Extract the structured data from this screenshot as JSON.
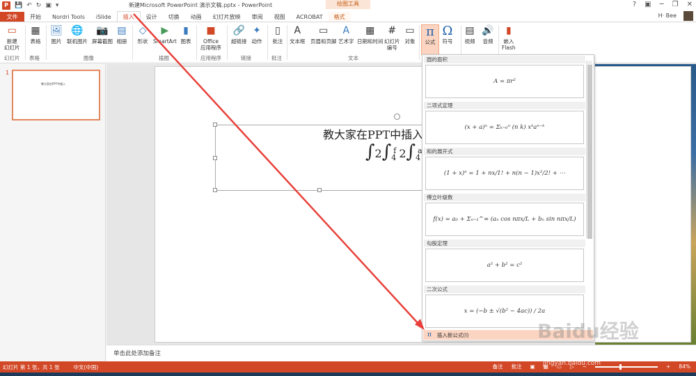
{
  "titlebar": {
    "title": "新建Microsoft PowerPoint 演示文稿.pptx - PowerPoint",
    "drawing_tools": "绘图工具",
    "help": "?"
  },
  "tabs": [
    "文件",
    "开始",
    "Nordri Tools",
    "iSlide",
    "插入",
    "设计",
    "切换",
    "动画",
    "幻灯片放映",
    "审阅",
    "视图",
    "ACROBAT",
    "格式"
  ],
  "user": "H· Bee",
  "ribbon": {
    "buttons": [
      {
        "label": "新建\n幻灯片",
        "icon": "new-slide-icon"
      },
      {
        "label": "表格",
        "icon": "table-icon"
      },
      {
        "label": "图片",
        "icon": "picture-icon"
      },
      {
        "label": "联机图片",
        "icon": "online-picture-icon"
      },
      {
        "label": "屏幕截图",
        "icon": "screenshot-icon"
      },
      {
        "label": "相册",
        "icon": "album-icon"
      },
      {
        "label": "形状",
        "icon": "shapes-icon"
      },
      {
        "label": "SmartArt",
        "icon": "smartart-icon"
      },
      {
        "label": "图表",
        "icon": "chart-icon"
      },
      {
        "label": "Office\n应用程序",
        "icon": "office-apps-icon"
      },
      {
        "label": "超链接",
        "icon": "hyperlink-icon"
      },
      {
        "label": "动作",
        "icon": "action-icon"
      },
      {
        "label": "批注",
        "icon": "comment-icon"
      },
      {
        "label": "文本框",
        "icon": "textbox-icon"
      },
      {
        "label": "页眉和页脚",
        "icon": "header-footer-icon"
      },
      {
        "label": "艺术字",
        "icon": "wordart-icon"
      },
      {
        "label": "日期和时间",
        "icon": "datetime-icon"
      },
      {
        "label": "幻灯片\n编号",
        "icon": "slide-number-icon"
      },
      {
        "label": "对象",
        "icon": "object-icon"
      },
      {
        "label": "公式",
        "icon": "pi-icon"
      },
      {
        "label": "符号",
        "icon": "omega-icon"
      },
      {
        "label": "视频",
        "icon": "video-icon"
      },
      {
        "label": "音频",
        "icon": "audio-icon"
      },
      {
        "label": "嵌入\nFlash",
        "icon": "flash-icon"
      }
    ],
    "groups": [
      "幻灯片",
      "表格",
      "图像",
      "插图",
      "应用程序",
      "链接",
      "批注",
      "文本"
    ]
  },
  "slide_panel": {
    "number": "1"
  },
  "slide": {
    "title": "教大家在PPT中插入",
    "formula": "∫2∫₄ᶠ2∫₄ᵃ"
  },
  "notes_placeholder": "单击此处添加备注",
  "equation_gallery": {
    "items": [
      {
        "header": "圆的面积",
        "formula": "A = πr²"
      },
      {
        "header": "二项式定理",
        "formula": "(x + a)ⁿ = Σₖ₌₀ⁿ (n k) xᵏaⁿ⁻ᵏ"
      },
      {
        "header": "和的展开式",
        "formula": "(1 + x)ⁿ = 1 + nx/1! + n(n − 1)x²/2! + ⋯"
      },
      {
        "header": "傅立叶级数",
        "formula": "f(x) = a₀ + Σₙ₌₁^∞ (aₙ cos nπx/L + bₙ sin nπx/L)"
      },
      {
        "header": "勾股定理",
        "formula": "a² + b² = c²"
      },
      {
        "header": "二次公式",
        "formula": "x = (−b ± √(b² − 4ac)) / 2a"
      }
    ],
    "insert_new": "插入新公式(I)"
  },
  "statusbar": {
    "slide_info": "幻灯片 第 1 张，共 1 张",
    "language": "中文(中国)",
    "notes": "备注",
    "comments": "批注",
    "zoom": "84%"
  },
  "watermark": {
    "brand": "Baidu经验",
    "url": "jingyan.baidu.com"
  }
}
